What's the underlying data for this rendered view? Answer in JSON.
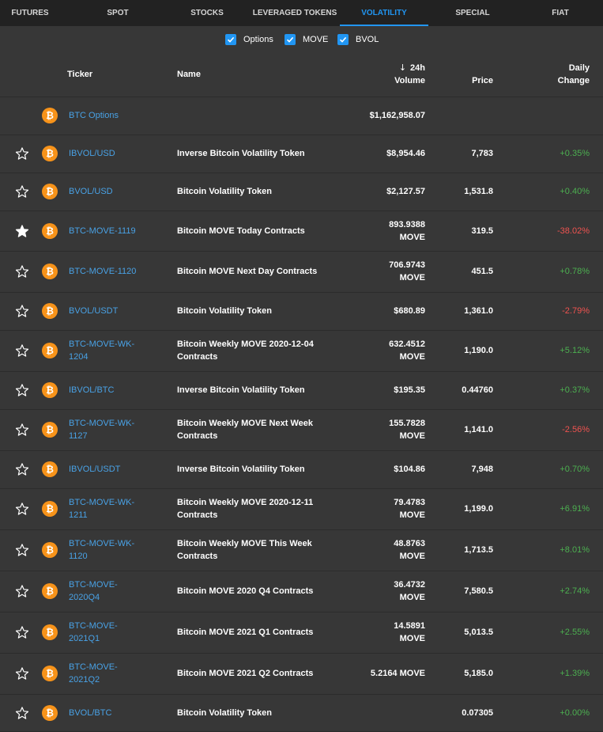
{
  "tabs": [
    "FUTURES",
    "SPOT",
    "STOCKS",
    "LEVERAGED TOKENS",
    "VOLATILITY",
    "SPECIAL",
    "FIAT"
  ],
  "active_tab": "VOLATILITY",
  "filters": [
    {
      "label": "Options",
      "checked": true
    },
    {
      "label": "MOVE",
      "checked": true
    },
    {
      "label": "BVOL",
      "checked": true
    }
  ],
  "columns": {
    "ticker": "Ticker",
    "name": "Name",
    "volume_line1": "24h",
    "volume_line2": "Volume",
    "price": "Price",
    "change_line1": "Daily",
    "change_line2": "Change",
    "sort_arrow": "↓"
  },
  "colors": {
    "accent": "#2196f3",
    "coin": "#f7931a",
    "positive": "#4caf50",
    "negative": "#ef5350",
    "link": "#49a2e6"
  },
  "rows": [
    {
      "star": "none",
      "ticker": [
        "BTC Options"
      ],
      "name": [],
      "volume": [
        "$1,162,958.07"
      ],
      "price": "",
      "change": "",
      "dir": ""
    },
    {
      "star": "empty",
      "ticker": [
        "IBVOL/USD"
      ],
      "name": [
        "Inverse Bitcoin Volatility Token"
      ],
      "volume": [
        "$8,954.46"
      ],
      "price": "7,783",
      "change": "+0.35%",
      "dir": "pos"
    },
    {
      "star": "empty",
      "ticker": [
        "BVOL/USD"
      ],
      "name": [
        "Bitcoin Volatility Token"
      ],
      "volume": [
        "$2,127.57"
      ],
      "price": "1,531.8",
      "change": "+0.40%",
      "dir": "pos"
    },
    {
      "star": "filled",
      "ticker": [
        "BTC-MOVE-1119"
      ],
      "name": [
        "Bitcoin MOVE Today Contracts"
      ],
      "volume": [
        "893.9388",
        "MOVE"
      ],
      "price": "319.5",
      "change": "-38.02%",
      "dir": "neg"
    },
    {
      "star": "empty",
      "ticker": [
        "BTC-MOVE-1120"
      ],
      "name": [
        "Bitcoin MOVE Next Day Contracts"
      ],
      "volume": [
        "706.9743",
        "MOVE"
      ],
      "price": "451.5",
      "change": "+0.78%",
      "dir": "pos"
    },
    {
      "star": "empty",
      "ticker": [
        "BVOL/USDT"
      ],
      "name": [
        "Bitcoin Volatility Token"
      ],
      "volume": [
        "$680.89"
      ],
      "price": "1,361.0",
      "change": "-2.79%",
      "dir": "neg"
    },
    {
      "star": "empty",
      "ticker": [
        "BTC-MOVE-WK-",
        "1204"
      ],
      "name": [
        "Bitcoin Weekly MOVE 2020-12-04",
        "Contracts"
      ],
      "volume": [
        "632.4512",
        "MOVE"
      ],
      "price": "1,190.0",
      "change": "+5.12%",
      "dir": "pos"
    },
    {
      "star": "empty",
      "ticker": [
        "IBVOL/BTC"
      ],
      "name": [
        "Inverse Bitcoin Volatility Token"
      ],
      "volume": [
        "$195.35"
      ],
      "price": "0.44760",
      "change": "+0.37%",
      "dir": "pos"
    },
    {
      "star": "empty",
      "ticker": [
        "BTC-MOVE-WK-",
        "1127"
      ],
      "name": [
        "Bitcoin Weekly MOVE Next Week",
        "Contracts"
      ],
      "volume": [
        "155.7828",
        "MOVE"
      ],
      "price": "1,141.0",
      "change": "-2.56%",
      "dir": "neg"
    },
    {
      "star": "empty",
      "ticker": [
        "IBVOL/USDT"
      ],
      "name": [
        "Inverse Bitcoin Volatility Token"
      ],
      "volume": [
        "$104.86"
      ],
      "price": "7,948",
      "change": "+0.70%",
      "dir": "pos"
    },
    {
      "star": "empty",
      "ticker": [
        "BTC-MOVE-WK-",
        "1211"
      ],
      "name": [
        "Bitcoin Weekly MOVE 2020-12-11",
        "Contracts"
      ],
      "volume": [
        "79.4783",
        "MOVE"
      ],
      "price": "1,199.0",
      "change": "+6.91%",
      "dir": "pos"
    },
    {
      "star": "empty",
      "ticker": [
        "BTC-MOVE-WK-",
        "1120"
      ],
      "name": [
        "Bitcoin Weekly MOVE This Week",
        "Contracts"
      ],
      "volume": [
        "48.8763",
        "MOVE"
      ],
      "price": "1,713.5",
      "change": "+8.01%",
      "dir": "pos"
    },
    {
      "star": "empty",
      "ticker": [
        "BTC-MOVE-",
        "2020Q4"
      ],
      "name": [
        "Bitcoin MOVE 2020 Q4 Contracts"
      ],
      "volume": [
        "36.4732",
        "MOVE"
      ],
      "price": "7,580.5",
      "change": "+2.74%",
      "dir": "pos"
    },
    {
      "star": "empty",
      "ticker": [
        "BTC-MOVE-",
        "2021Q1"
      ],
      "name": [
        "Bitcoin MOVE 2021 Q1 Contracts"
      ],
      "volume": [
        "14.5891",
        "MOVE"
      ],
      "price": "5,013.5",
      "change": "+2.55%",
      "dir": "pos"
    },
    {
      "star": "empty",
      "ticker": [
        "BTC-MOVE-",
        "2021Q2"
      ],
      "name": [
        "Bitcoin MOVE 2021 Q2 Contracts"
      ],
      "volume": [
        "5.2164 MOVE"
      ],
      "price": "5,185.0",
      "change": "+1.39%",
      "dir": "pos"
    },
    {
      "star": "empty",
      "ticker": [
        "BVOL/BTC"
      ],
      "name": [
        "Bitcoin Volatility Token"
      ],
      "volume": [
        ""
      ],
      "price": "0.07305",
      "change": "+0.00%",
      "dir": "pos"
    }
  ]
}
